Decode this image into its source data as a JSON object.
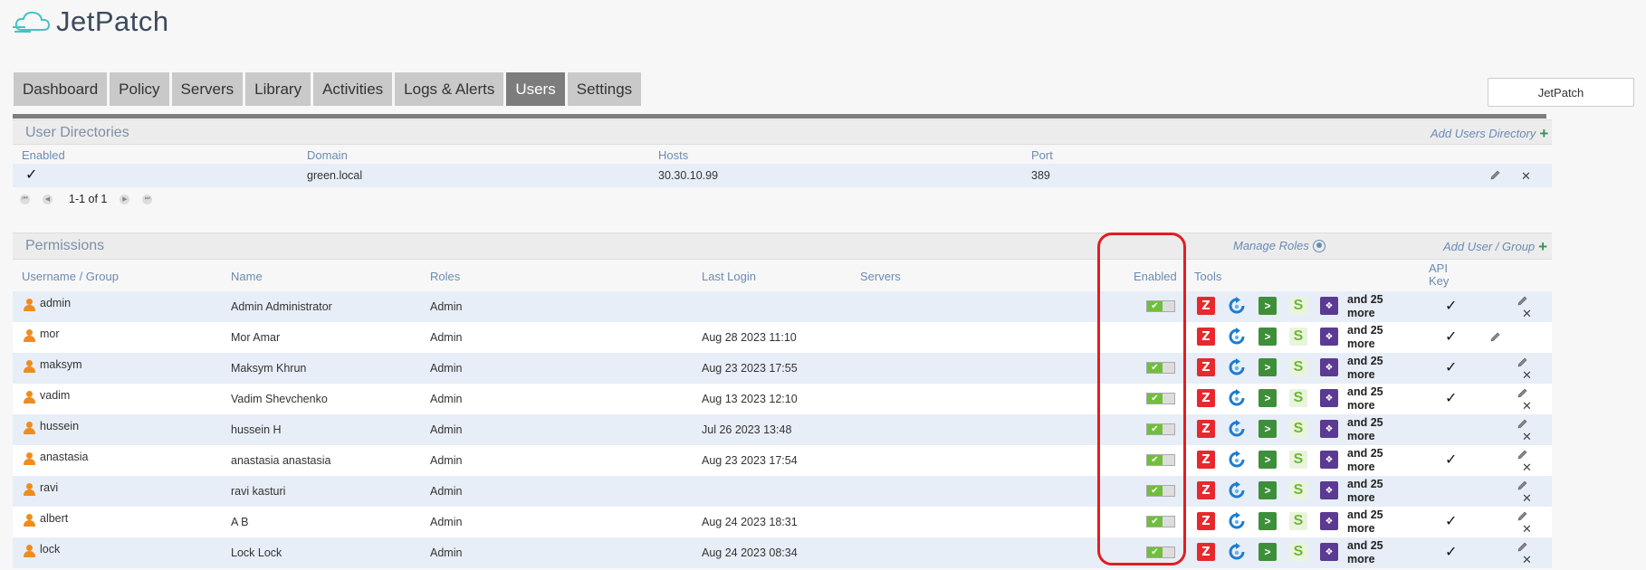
{
  "app": {
    "logo_text": "JetPatch"
  },
  "nav": {
    "tabs": [
      {
        "label": "Dashboard",
        "active": false
      },
      {
        "label": "Policy",
        "active": false
      },
      {
        "label": "Servers",
        "active": false
      },
      {
        "label": "Library",
        "active": false
      },
      {
        "label": "Activities",
        "active": false
      },
      {
        "label": "Logs & Alerts",
        "active": false
      },
      {
        "label": "Users",
        "active": true
      },
      {
        "label": "Settings",
        "active": false
      }
    ],
    "account_button": "JetPatch"
  },
  "user_directories": {
    "title": "User Directories",
    "add_link": "Add Users Directory",
    "columns": [
      "Enabled",
      "Domain",
      "Hosts",
      "Port"
    ],
    "rows": [
      {
        "enabled": "✓",
        "domain": "green.local",
        "hosts": "30.30.10.99",
        "port": "389"
      }
    ],
    "pager": "1-1 of 1"
  },
  "permissions": {
    "title": "Permissions",
    "manage_roles": "Manage Roles",
    "add_link": "Add User / Group",
    "columns": {
      "username": "Username / Group",
      "name": "Name",
      "roles": "Roles",
      "last_login": "Last Login",
      "servers": "Servers",
      "enabled": "Enabled",
      "tools": "Tools",
      "api_key_1": "API",
      "api_key_2": "Key"
    },
    "more_line1": "and 25",
    "more_line2": "more",
    "rows": [
      {
        "username": "admin",
        "name": "Admin Administrator",
        "role": "Admin",
        "last_login": "",
        "enabled": true,
        "api_key": true,
        "pencil": true,
        "delete": true
      },
      {
        "username": "mor",
        "name": "Mor Amar",
        "role": "Admin",
        "last_login": "Aug 28 2023 11:10",
        "enabled": false,
        "api_key": true,
        "pencil": true,
        "delete": false
      },
      {
        "username": "maksym",
        "name": "Maksym Khrun",
        "role": "Admin",
        "last_login": "Aug 23 2023 17:55",
        "enabled": true,
        "api_key": true,
        "pencil": true,
        "delete": true
      },
      {
        "username": "vadim",
        "name": "Vadim Shevchenko",
        "role": "Admin",
        "last_login": "Aug 13 2023 12:10",
        "enabled": true,
        "api_key": true,
        "pencil": true,
        "delete": true
      },
      {
        "username": "hussein",
        "name": "hussein H",
        "role": "Admin",
        "last_login": "Jul 26 2023 13:48",
        "enabled": true,
        "api_key": false,
        "pencil": true,
        "delete": true
      },
      {
        "username": "anastasia",
        "name": "anastasia anastasia",
        "role": "Admin",
        "last_login": "Aug 23 2023 17:54",
        "enabled": true,
        "api_key": true,
        "pencil": true,
        "delete": true
      },
      {
        "username": "ravi",
        "name": "ravi kasturi",
        "role": "Admin",
        "last_login": "",
        "enabled": true,
        "api_key": false,
        "pencil": true,
        "delete": true
      },
      {
        "username": "albert",
        "name": "A B",
        "role": "Admin",
        "last_login": "Aug 24 2023 18:31",
        "enabled": true,
        "api_key": true,
        "pencil": true,
        "delete": true
      },
      {
        "username": "lock",
        "name": "Lock Lock",
        "role": "Admin",
        "last_login": "Aug 24 2023 08:34",
        "enabled": true,
        "api_key": true,
        "pencil": true,
        "delete": true
      }
    ]
  },
  "icons": {
    "user": "user-icon",
    "tools": [
      "zerto-icon",
      "refresh-icon",
      "terminal-icon",
      "s-icon",
      "puzzle-icon"
    ],
    "edit": "pencil-icon",
    "delete": "close-icon",
    "add": "plus-icon"
  },
  "colors": {
    "active_tab": "#7d7d7d",
    "tab": "#c9c9c9",
    "link": "#6b8bb3",
    "row_alt": "#e8eef7",
    "toggle_on": "#6fbf3a",
    "highlight": "#e21d22",
    "user_icon": "#f08c1e"
  }
}
